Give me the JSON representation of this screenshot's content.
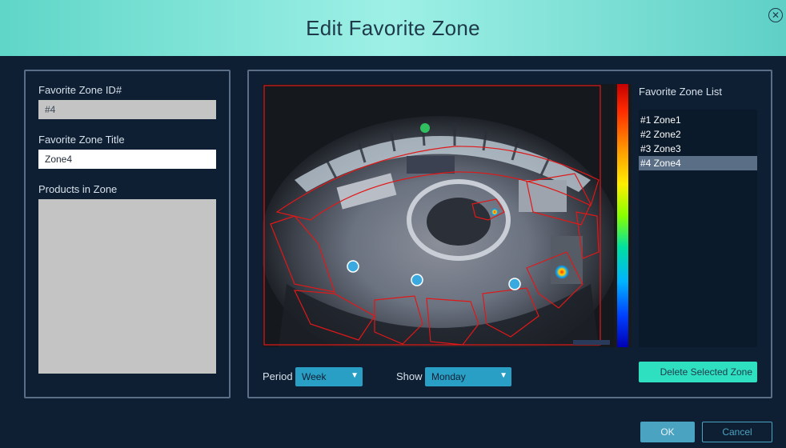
{
  "header": {
    "title": "Edit Favorite Zone",
    "close_icon": "close-circle-icon"
  },
  "left_panel": {
    "zone_id_label": "Favorite Zone ID#",
    "zone_id_value": "#4",
    "zone_title_label": "Favorite Zone Title",
    "zone_title_value": "Zone4",
    "products_label": "Products in Zone"
  },
  "camera": {
    "view": "fisheye-heatmap",
    "marker_icons": [
      "person-pin-icon"
    ],
    "zone_outline_color": "#e01818"
  },
  "zone_list": {
    "label": "Favorite Zone List",
    "items": [
      {
        "label": "#1 Zone1",
        "selected": false
      },
      {
        "label": "#2 Zone2",
        "selected": false
      },
      {
        "label": "#3 Zone3",
        "selected": false
      },
      {
        "label": "#4 Zone4",
        "selected": true
      }
    ],
    "delete_label": "Delete Selected Zone"
  },
  "controls": {
    "period_label": "Period",
    "period_value": "Week",
    "show_label": "Show",
    "show_value": "Monday"
  },
  "footer": {
    "ok_label": "OK",
    "cancel_label": "Cancel"
  },
  "colors": {
    "header_accent": "#7ee8dc",
    "background": "#0f1f33",
    "button_teal": "#2ee0c0",
    "select_blue": "#2a9fc6",
    "selected_item": "#5a6f86"
  }
}
